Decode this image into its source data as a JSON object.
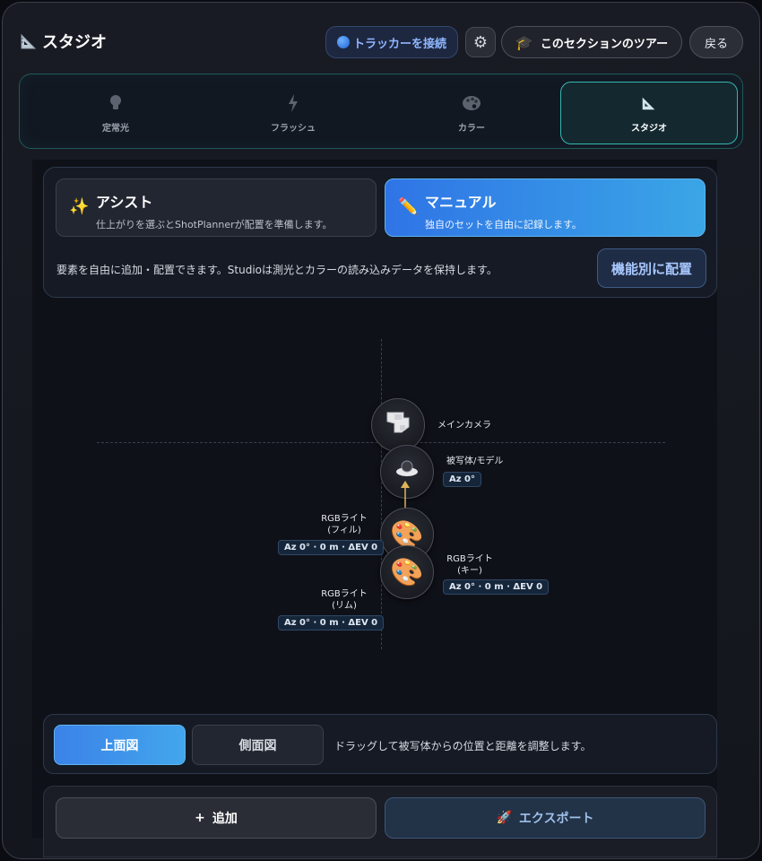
{
  "header": {
    "app_title": "スタジオ",
    "tracker_label": "トラッカーを接続",
    "tour_label": "このセクションのツアー",
    "back_label": "戻る"
  },
  "modes": [
    {
      "label": "定常光",
      "icon": "bulb-icon",
      "active": false
    },
    {
      "label": "フラッシュ",
      "icon": "flash-icon",
      "active": false
    },
    {
      "label": "カラー",
      "icon": "palette-icon",
      "active": false
    },
    {
      "label": "スタジオ",
      "icon": "ruler-icon",
      "active": true
    }
  ],
  "assist_panel": {
    "assist": {
      "title": "アシスト",
      "desc": "仕上がりを選ぶとShotPlannerが配置を準備します。"
    },
    "manual": {
      "title": "マニュアル",
      "desc": "独自のセットを自由に記録します。"
    },
    "description": "要素を自由に追加・配置できます。Studioは測光とカラーの読み込みデータを保持します。",
    "arrange_label": "機能別に配置"
  },
  "stage": {
    "camera": {
      "label": "メインカメラ"
    },
    "subject": {
      "label": "被写体/モデル",
      "chip": "Az 0°"
    },
    "fill_light": {
      "label_line1": "RGBライト",
      "label_line2": "(フィル)",
      "chip": "Az 0° · 0 m · ΔEV 0"
    },
    "key_light": {
      "label_line1": "RGBライト",
      "label_line2": "(キー)",
      "chip": "Az 0° · 0 m · ΔEV 0"
    },
    "rim_light": {
      "label_line1": "RGBライト",
      "label_line2": "(リム)",
      "chip": "Az 0° · 0 m · ΔEV 0"
    }
  },
  "view": {
    "top_label": "上面図",
    "side_label": "側面図",
    "hint": "ドラッグして被写体からの位置と距離を調整します。"
  },
  "actions": {
    "add_label": "追加",
    "export_label": "エクスポート"
  },
  "colors": {
    "accent_teal": "#36b7b2",
    "accent_blue": "#2f74e6",
    "background": "#14161d"
  }
}
